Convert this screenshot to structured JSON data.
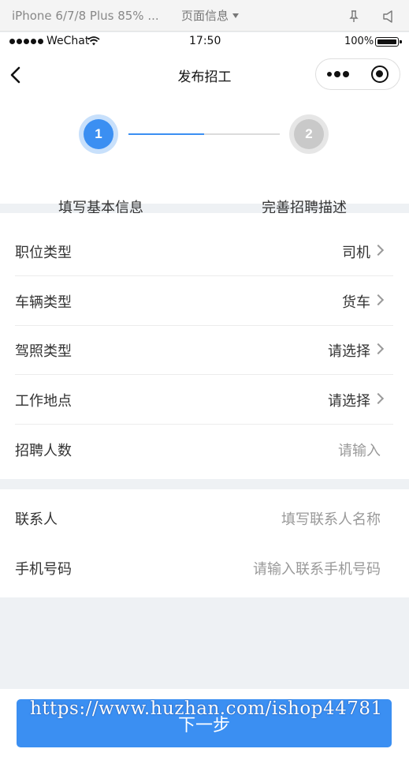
{
  "simulator": {
    "device": "iPhone 6/7/8 Plus 85% ...",
    "page_menu": "页面信息"
  },
  "status_bar": {
    "carrier": "WeChat",
    "time": "17:50",
    "battery": "100%"
  },
  "nav": {
    "title": "发布招工"
  },
  "steps": {
    "items": [
      {
        "number": "1",
        "label": "填写基本信息",
        "active": true
      },
      {
        "number": "2",
        "label": "完善招聘描述",
        "active": false
      }
    ],
    "progress": 0.5,
    "colors": {
      "active": "#3b8ff2",
      "active_ring": "#c8e0fb",
      "inactive": "#c9c9c9"
    }
  },
  "form": {
    "job_type": {
      "label": "职位类型",
      "value": "司机"
    },
    "vehicle_type": {
      "label": "车辆类型",
      "value": "货车"
    },
    "license_type": {
      "label": "驾照类型",
      "value": "请选择"
    },
    "work_location": {
      "label": "工作地点",
      "value": "请选择"
    },
    "headcount": {
      "label": "招聘人数",
      "placeholder": "请输入"
    },
    "contact": {
      "label": "联系人",
      "placeholder": "填写联系人名称"
    },
    "phone": {
      "label": "手机号码",
      "placeholder": "请输入联系手机号码"
    }
  },
  "footer": {
    "next_label": "下一步",
    "watermark": "https://www.huzhan.com/ishop44781"
  },
  "colors": {
    "primary": "#3b8ff2",
    "background": "#eef1f4"
  }
}
